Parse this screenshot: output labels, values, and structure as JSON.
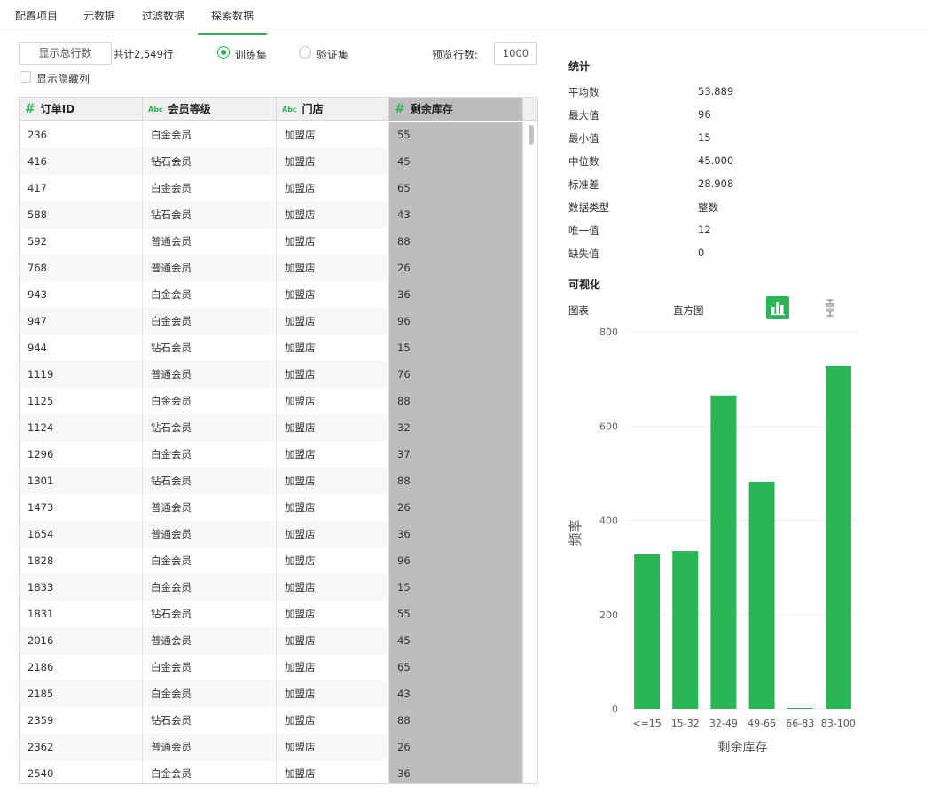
{
  "tabs": [
    {
      "label": "配置项目"
    },
    {
      "label": "元数据"
    },
    {
      "label": "过滤数据"
    },
    {
      "label": "探索数据"
    }
  ],
  "toolbar": {
    "show_total_button": "显示总行数",
    "total_text": "共计2,549行",
    "radio_train": "训练集",
    "radio_valid": "验证集",
    "preview_label": "预览行数:",
    "preview_value": "1000",
    "show_hidden_label": "显示隐藏列"
  },
  "table": {
    "columns": [
      {
        "label": "订单ID",
        "type": "#"
      },
      {
        "label": "会员等级",
        "type": "Abc"
      },
      {
        "label": "门店",
        "type": "Abc"
      },
      {
        "label": "剩余库存",
        "type": "#"
      }
    ],
    "rows": [
      [
        "236",
        "白金会员",
        "加盟店",
        "55"
      ],
      [
        "416",
        "钻石会员",
        "加盟店",
        "45"
      ],
      [
        "417",
        "白金会员",
        "加盟店",
        "65"
      ],
      [
        "588",
        "钻石会员",
        "加盟店",
        "43"
      ],
      [
        "592",
        "普通会员",
        "加盟店",
        "88"
      ],
      [
        "768",
        "普通会员",
        "加盟店",
        "26"
      ],
      [
        "943",
        "白金会员",
        "加盟店",
        "36"
      ],
      [
        "947",
        "白金会员",
        "加盟店",
        "96"
      ],
      [
        "944",
        "钻石会员",
        "加盟店",
        "15"
      ],
      [
        "1119",
        "普通会员",
        "加盟店",
        "76"
      ],
      [
        "1125",
        "白金会员",
        "加盟店",
        "88"
      ],
      [
        "1124",
        "钻石会员",
        "加盟店",
        "32"
      ],
      [
        "1296",
        "白金会员",
        "加盟店",
        "37"
      ],
      [
        "1301",
        "钻石会员",
        "加盟店",
        "88"
      ],
      [
        "1473",
        "普通会员",
        "加盟店",
        "26"
      ],
      [
        "1654",
        "普通会员",
        "加盟店",
        "36"
      ],
      [
        "1828",
        "白金会员",
        "加盟店",
        "96"
      ],
      [
        "1833",
        "白金会员",
        "加盟店",
        "15"
      ],
      [
        "1831",
        "钻石会员",
        "加盟店",
        "55"
      ],
      [
        "2016",
        "普通会员",
        "加盟店",
        "45"
      ],
      [
        "2186",
        "白金会员",
        "加盟店",
        "65"
      ],
      [
        "2185",
        "白金会员",
        "加盟店",
        "43"
      ],
      [
        "2359",
        "钻石会员",
        "加盟店",
        "88"
      ],
      [
        "2362",
        "普通会员",
        "加盟店",
        "26"
      ],
      [
        "2540",
        "白金会员",
        "加盟店",
        "36"
      ]
    ]
  },
  "stats": {
    "title": "统计",
    "items": [
      {
        "label": "平均数",
        "value": "53.889"
      },
      {
        "label": "最大值",
        "value": "96"
      },
      {
        "label": "最小值",
        "value": "15"
      },
      {
        "label": "中位数",
        "value": "45.000"
      },
      {
        "label": "标准差",
        "value": "28.908"
      },
      {
        "label": "数据类型",
        "value": "整数"
      },
      {
        "label": "唯一值",
        "value": "12"
      },
      {
        "label": "缺失值",
        "value": "0"
      }
    ]
  },
  "viz": {
    "title": "可视化",
    "chart_label": "图表",
    "chart_type": "直方图"
  },
  "colors": {
    "accent": "#2ab656",
    "selected_column": "#bdbdbd"
  },
  "icons": [
    "histogram-icon",
    "boxplot-icon",
    "number-type-icon",
    "text-type-icon"
  ],
  "chart_data": {
    "type": "bar",
    "categories": [
      "<=15",
      "15-32",
      "32-49",
      "49-66",
      "66-83",
      "83-100"
    ],
    "values": [
      328,
      335,
      665,
      482,
      2,
      728
    ],
    "xlabel": "剩余库存",
    "ylabel": "频率",
    "ylim": [
      0,
      800
    ],
    "yticks": [
      0,
      200,
      400,
      600,
      800
    ],
    "grid": true,
    "color": "#2ab656"
  }
}
